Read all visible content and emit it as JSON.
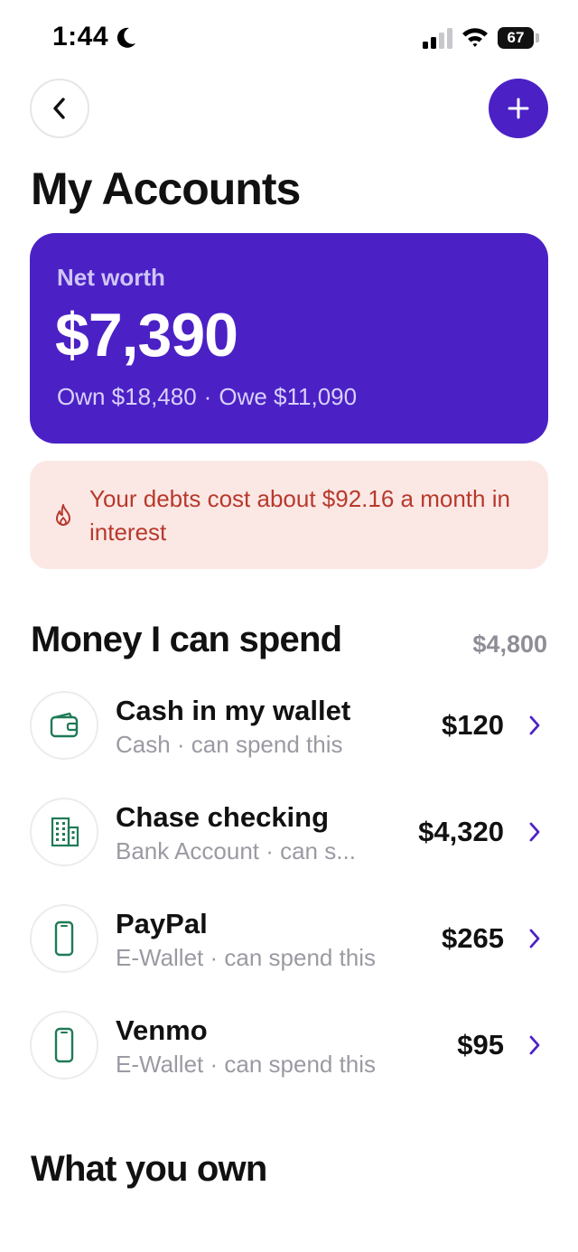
{
  "status_bar": {
    "time": "1:44",
    "battery": "67"
  },
  "header": {
    "title": "My Accounts",
    "back_icon": "chevron-left-icon",
    "add_icon": "plus-icon"
  },
  "net_worth": {
    "label": "Net worth",
    "amount": "$7,390",
    "own": "Own $18,480",
    "separator": "·",
    "owe": "Owe $11,090"
  },
  "alert": {
    "icon": "flame-icon",
    "text": "Your debts cost about $92.16 a month in interest"
  },
  "spend_section": {
    "title": "Money I can spend",
    "total": "$4,800",
    "accounts": [
      {
        "name": "Cash in my wallet",
        "subtitle": "Cash · can spend this",
        "amount": "$120",
        "icon": "wallet-icon"
      },
      {
        "name": "Chase checking",
        "subtitle": "Bank Account · can s...",
        "amount": "$4,320",
        "icon": "building-icon"
      },
      {
        "name": "PayPal",
        "subtitle": "E-Wallet · can spend this",
        "amount": "$265",
        "icon": "phone-icon"
      },
      {
        "name": "Venmo",
        "subtitle": "E-Wallet · can spend this",
        "amount": "$95",
        "icon": "phone-icon"
      }
    ]
  },
  "own_section": {
    "title": "What you own"
  },
  "colors": {
    "brand": "#4b21c6",
    "alert_bg": "#fbe8e5",
    "alert_text": "#b8392c",
    "icon_green": "#1f7a55",
    "muted": "#9a9aa3"
  }
}
